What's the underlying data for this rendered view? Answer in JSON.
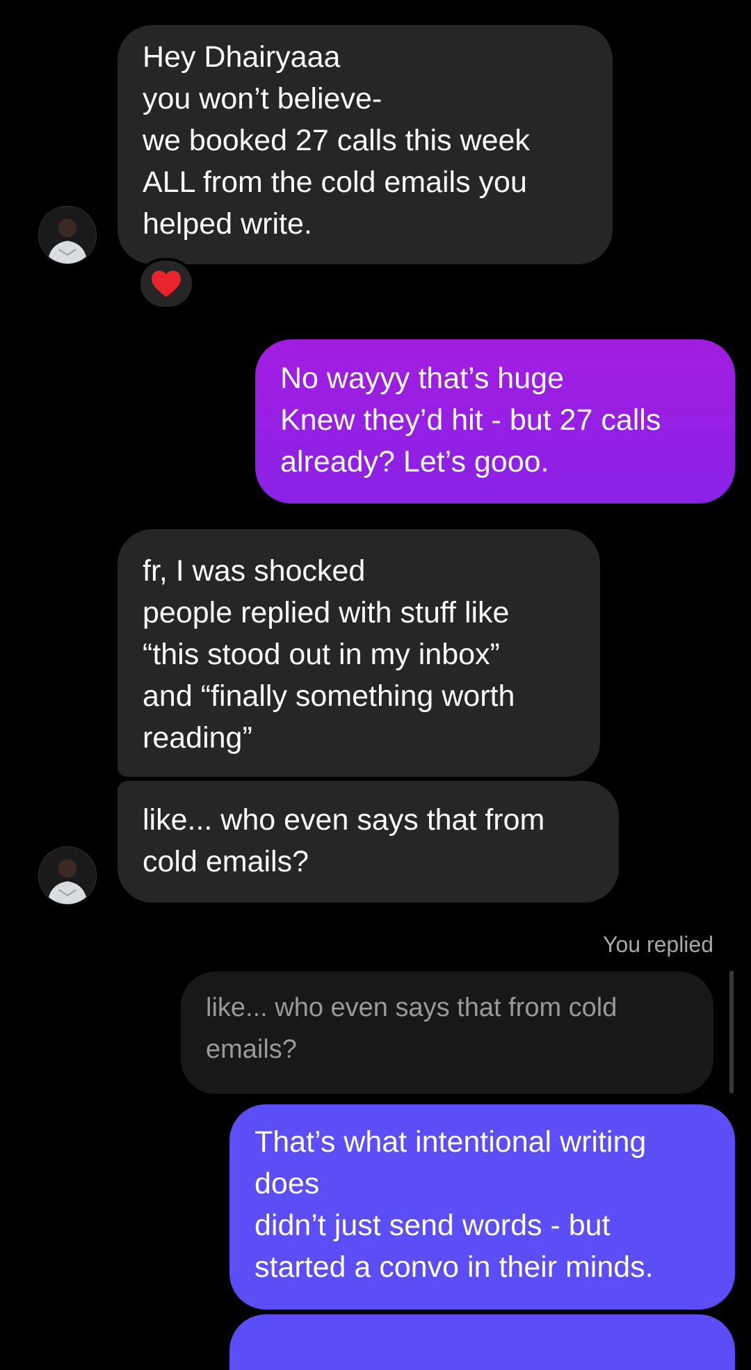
{
  "messages": [
    {
      "id": "m1",
      "direction": "incoming",
      "text": "Hey Dhairyaaa\nyou won’t believe-\nwe booked 27 calls this week\nALL from the cold emails you\nhelped write.",
      "reaction": "heart"
    },
    {
      "id": "m2",
      "direction": "outgoing",
      "text": "No wayyy that’s huge\nKnew they’d hit - but 27 calls\nalready? Let’s gooo."
    },
    {
      "id": "m3",
      "direction": "incoming",
      "text": "fr, I was shocked\npeople replied with stuff like\n“this stood out in my inbox”\nand “finally something worth\nreading”"
    },
    {
      "id": "m4",
      "direction": "incoming",
      "text": "like... who even says that from\ncold emails?"
    },
    {
      "id": "m5",
      "direction": "outgoing",
      "reply_label": "You replied",
      "quoted_text": "like... who even says that from cold\nemails?",
      "text": "That’s what intentional writing\ndoes\ndidn’t just send words - but\nstarted a convo in their minds."
    }
  ],
  "icons": {
    "avatar": "profile-avatar-icon",
    "reaction": "heart-icon"
  },
  "colors": {
    "background": "#000000",
    "incoming_bubble": "#262626",
    "outgoing_gradient_top": "#a21de0",
    "outgoing_gradient_bottom": "#8a22e6",
    "outgoing_blue": "#5b4ef6",
    "reaction_heart": "#e8252e",
    "reply_quote": "#181818"
  }
}
